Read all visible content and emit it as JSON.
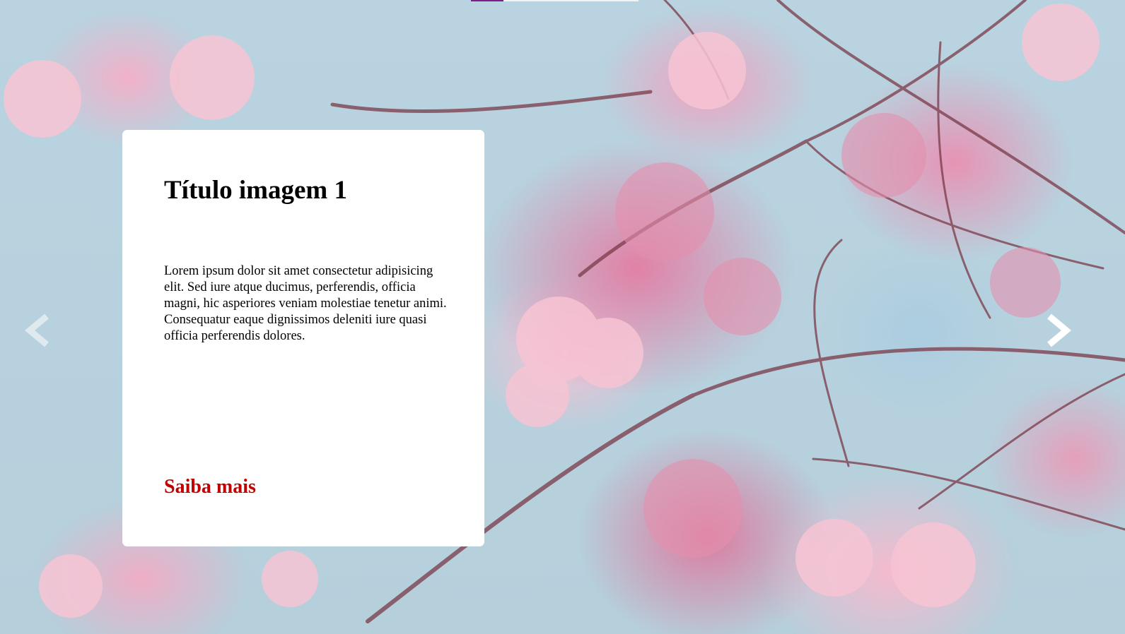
{
  "slide": {
    "title": "Título imagem 1",
    "text": "Lorem ipsum dolor sit amet consectetur adipisicing elit. Sed iure atque ducimus, perferendis, officia magni, hic asperiores veniam molestiae tenetur animi. Consequatur eaque dignissimos deleniti iure quasi officia perferendis dolores.",
    "link_label": "Saiba mais",
    "background_description_icon": "cherry-blossom-photo",
    "current_index": 1
  },
  "controls": {
    "prev_icon": "chevron-left-icon",
    "next_icon": "chevron-right-icon"
  },
  "colors": {
    "link": "#c00000",
    "card_bg": "#ffffff",
    "indicator_active": "#7d1c8a",
    "indicator_track": "#f2f2f2",
    "arrow_prev": "#e6eef2",
    "arrow_next": "#ffffff"
  }
}
